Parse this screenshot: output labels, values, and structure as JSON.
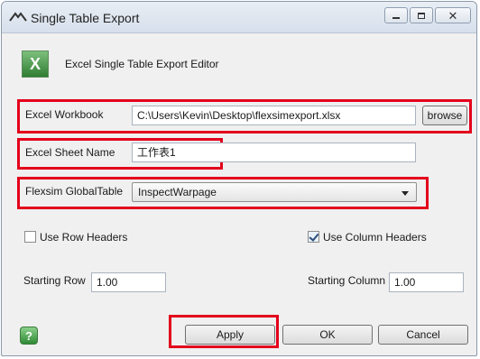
{
  "window": {
    "title": "Single Table Export",
    "icon": "flexsim-logo-icon",
    "controls": [
      "minimize-icon",
      "maximize-icon",
      "close-icon"
    ]
  },
  "header": {
    "icon": "excel-icon",
    "icon_letter": "X",
    "title": "Excel Single Table Export Editor"
  },
  "workbook": {
    "label": "Excel Workbook",
    "value": "C:\\Users\\Kevin\\Desktop\\flexsimexport.xlsx",
    "browse_label": "browse"
  },
  "sheet": {
    "label": "Excel Sheet Name",
    "value": "工作表1"
  },
  "globaltable": {
    "label": "Flexsim GlobalTable",
    "selected": "InspectWarpage"
  },
  "options": {
    "row_headers": {
      "label": "Use Row Headers",
      "checked": false
    },
    "column_headers": {
      "label": "Use Column Headers",
      "checked": true
    }
  },
  "start": {
    "row_label": "Starting Row",
    "row_value": "1.00",
    "column_label": "Starting Column",
    "column_value": "1.00"
  },
  "buttons": {
    "help": "?",
    "apply": "Apply",
    "ok": "OK",
    "cancel": "Cancel"
  },
  "colors": {
    "highlight": "#e3001b",
    "excel_green": "#2f7d32"
  }
}
